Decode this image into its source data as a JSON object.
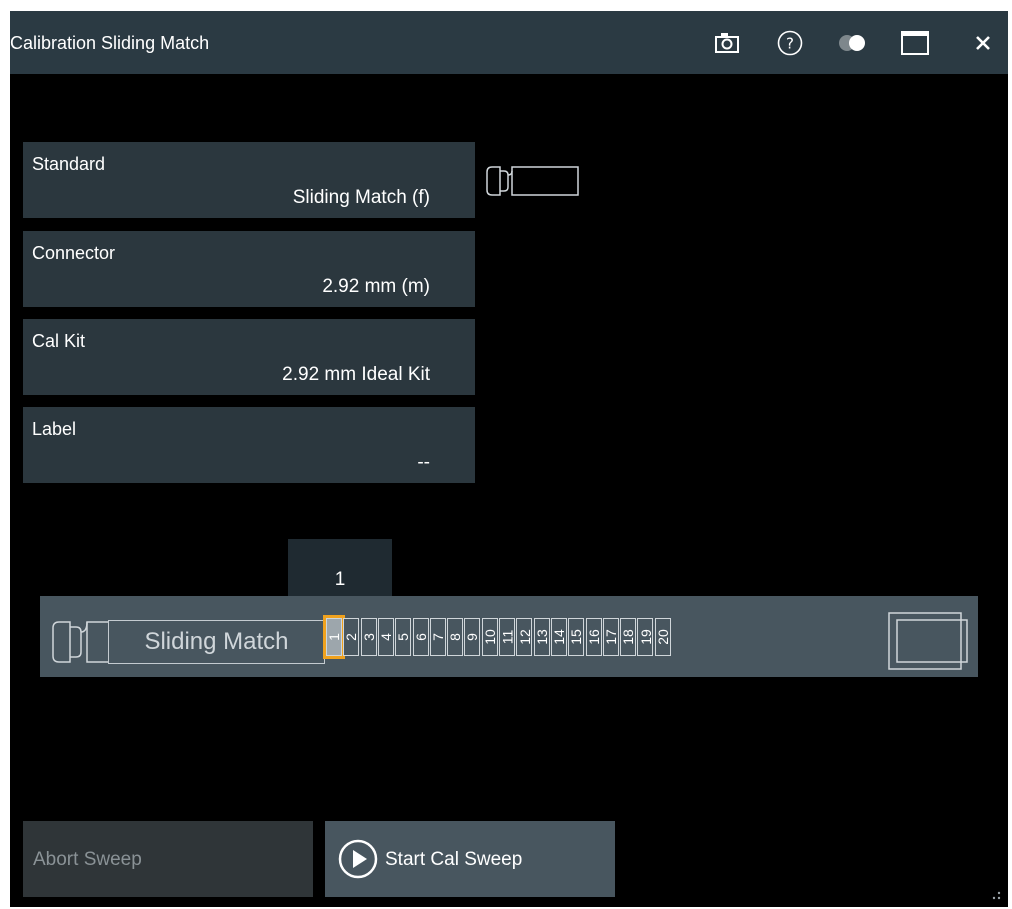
{
  "window": {
    "title": "Calibration Sliding Match"
  },
  "titlebar_icons": [
    "camera-icon",
    "help-icon",
    "theme-toggle-icon",
    "maximize-icon",
    "close-icon"
  ],
  "fields": [
    {
      "label": "Standard",
      "value": "Sliding Match (f)"
    },
    {
      "label": "Connector",
      "value": "2.92 mm (m)"
    },
    {
      "label": "Cal Kit",
      "value": "2.92 mm Ideal Kit"
    },
    {
      "label": "Label",
      "value": "--"
    }
  ],
  "slider": {
    "current_position": "1",
    "label": "Sliding Match",
    "positions": [
      "1",
      "2",
      "3",
      "4",
      "5",
      "6",
      "7",
      "8",
      "9",
      "10",
      "11",
      "12",
      "13",
      "14",
      "15",
      "16",
      "17",
      "18",
      "19",
      "20"
    ],
    "selected_index": 0
  },
  "buttons": {
    "abort_label": "Abort Sweep",
    "start_label": "Start Cal Sweep"
  },
  "colors": {
    "titlebar": "#2b3a43",
    "field_bg": "#2b373e",
    "rail": "#48565f",
    "highlight": "#f0a21e"
  }
}
